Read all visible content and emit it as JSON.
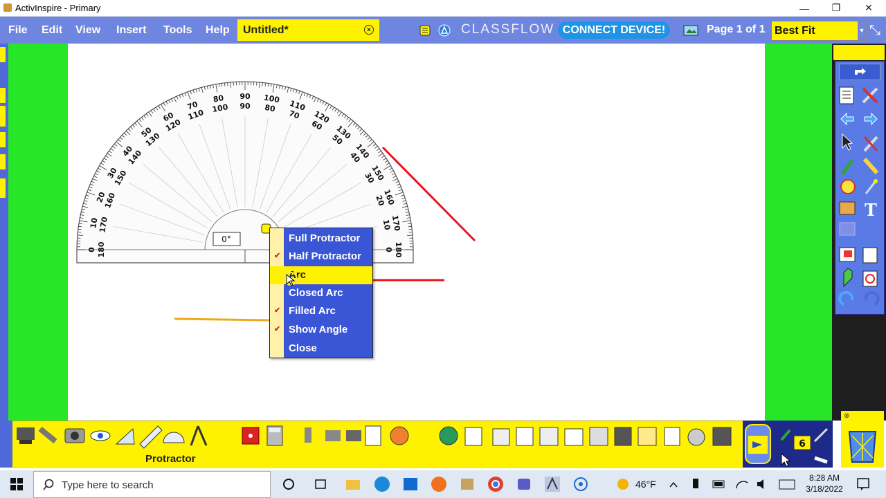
{
  "window": {
    "title": "ActivInspire - Primary",
    "minimize": "—",
    "maximize": "❐",
    "close": "✕"
  },
  "menubar": {
    "items": [
      "File",
      "Edit",
      "View",
      "Insert",
      "Tools",
      "Help"
    ],
    "doc_tab": "Untitled*",
    "classflow": "CLASSFLOW",
    "connect": "CONNECT DEVICE!",
    "page_info": "Page 1 of 1",
    "zoom": "Best Fit"
  },
  "protractor": {
    "angle_readout": "0°",
    "outer_scale_labels": [
      "0",
      "10",
      "20",
      "30",
      "40",
      "50",
      "60",
      "70",
      "80",
      "90",
      "100",
      "110",
      "120",
      "130",
      "140",
      "150",
      "160",
      "170",
      "180"
    ]
  },
  "context_menu": {
    "items": [
      {
        "label": "Full Protractor",
        "checked": false,
        "highlighted": false
      },
      {
        "label": "Half Protractor",
        "checked": true,
        "highlighted": false
      },
      {
        "label": "Arc",
        "checked": false,
        "highlighted": true
      },
      {
        "label": "Closed Arc",
        "checked": false,
        "highlighted": false
      },
      {
        "label": "Filled Arc",
        "checked": true,
        "highlighted": false
      },
      {
        "label": "Show Angle",
        "checked": true,
        "highlighted": false
      },
      {
        "label": "Close",
        "checked": false,
        "highlighted": false
      }
    ]
  },
  "bottom_toolbar": {
    "active_tool_label": "Protractor",
    "pen_width": "6"
  },
  "taskbar": {
    "search_placeholder": "Type here to search",
    "temperature": "46°F",
    "time": "8:28 AM",
    "date": "3/18/2022"
  },
  "colors": {
    "menubar": "#6f86e0",
    "accent_yellow": "#fff200",
    "workspace_green": "#27e527",
    "connect_blue": "#1f94e6",
    "line_red": "#e8141a",
    "line_orange": "#f0a818"
  }
}
